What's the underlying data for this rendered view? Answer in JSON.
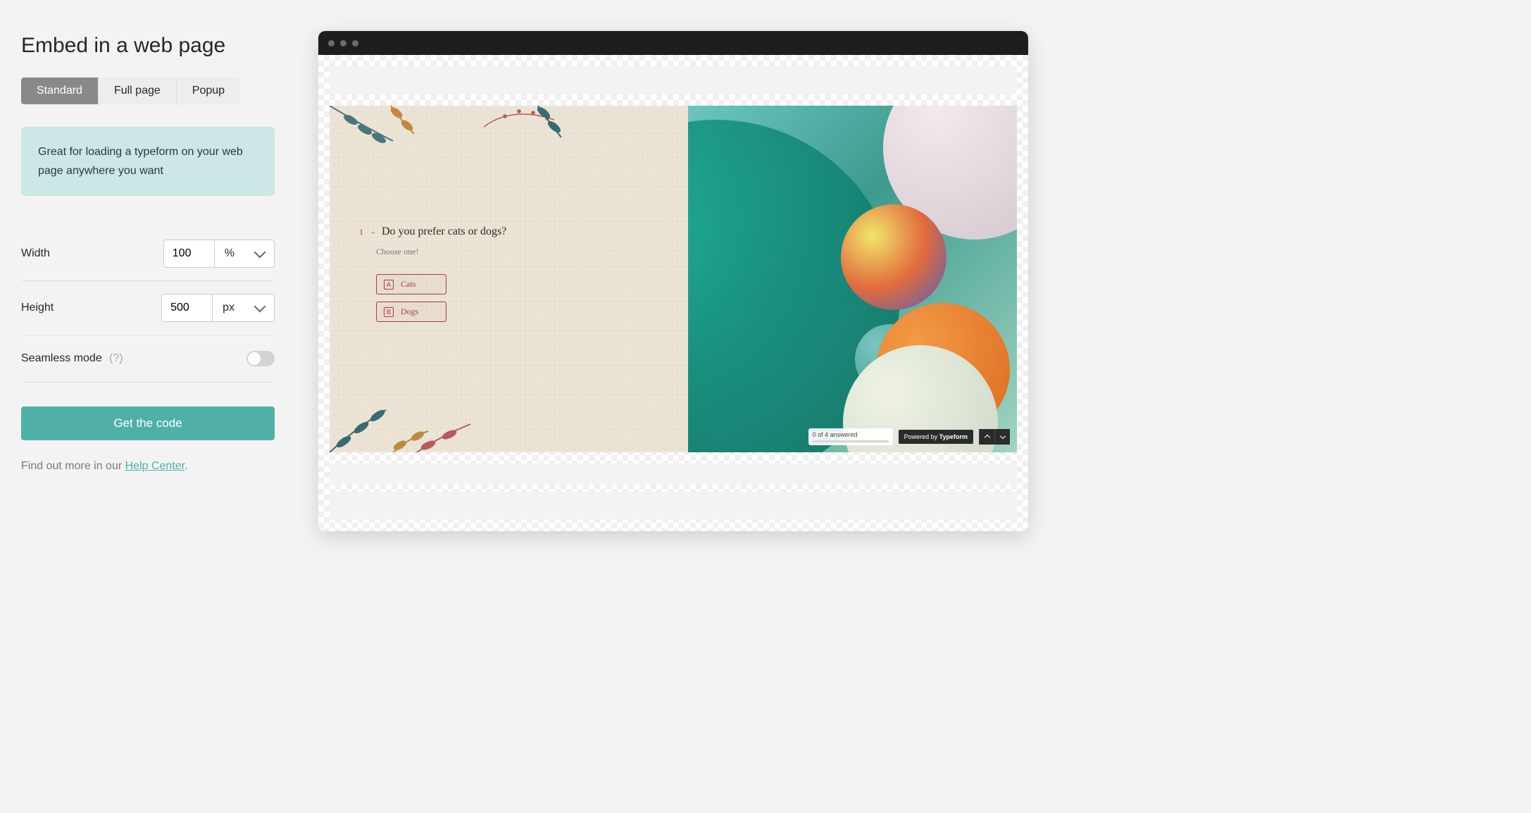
{
  "panel": {
    "title": "Embed in a web page",
    "tabs": [
      "Standard",
      "Full page",
      "Popup"
    ],
    "active_tab": "Standard",
    "info": "Great for loading a typeform on your web page anywhere you want",
    "width": {
      "label": "Width",
      "value": "100",
      "unit": "%"
    },
    "height": {
      "label": "Height",
      "value": "500",
      "unit": "px"
    },
    "seamless": {
      "label": "Seamless mode",
      "help": "(?)",
      "on": false
    },
    "cta": "Get the code",
    "help_prefix": "Find out more in our ",
    "help_link": "Help Center",
    "help_suffix": "."
  },
  "preview": {
    "question_num": "1",
    "question": "Do you prefer cats or dogs?",
    "subtext": "Choose one!",
    "choices": [
      {
        "key": "A",
        "label": "Cats"
      },
      {
        "key": "B",
        "label": "Dogs"
      }
    ],
    "progress_text": "0 of 4 answered",
    "powered_prefix": "Powered by ",
    "powered_brand": "Typeform"
  }
}
